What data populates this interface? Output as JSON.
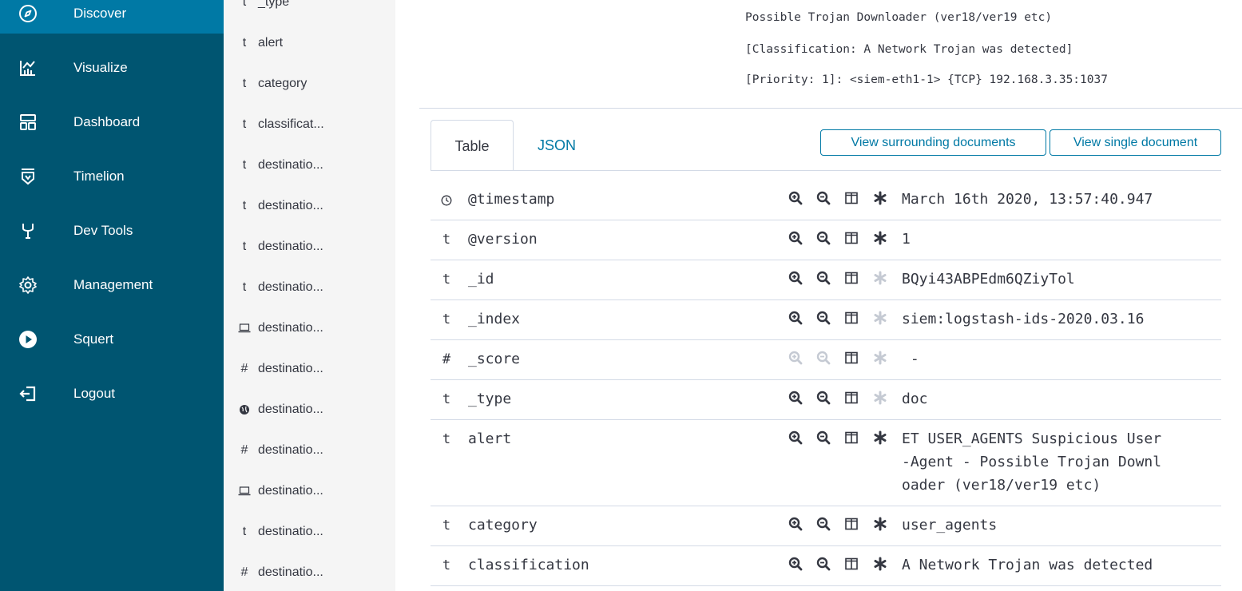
{
  "nav": {
    "items": [
      {
        "label": "Discover",
        "icon": "compass-icon",
        "active": true
      },
      {
        "label": "Visualize",
        "icon": "chart-icon"
      },
      {
        "label": "Dashboard",
        "icon": "dashboard-icon"
      },
      {
        "label": "Timelion",
        "icon": "timelion-icon"
      },
      {
        "label": "Dev Tools",
        "icon": "wrench-icon"
      },
      {
        "label": "Management",
        "icon": "gear-icon"
      },
      {
        "label": "Squert",
        "icon": "play-icon"
      },
      {
        "label": "Logout",
        "icon": "logout-icon"
      }
    ]
  },
  "fields": {
    "items": [
      {
        "type": "t",
        "name": "_type"
      },
      {
        "type": "t",
        "name": "alert"
      },
      {
        "type": "t",
        "name": "category"
      },
      {
        "type": "t",
        "name": "classificat..."
      },
      {
        "type": "t",
        "name": "destinatio..."
      },
      {
        "type": "t",
        "name": "destinatio..."
      },
      {
        "type": "t",
        "name": "destinatio..."
      },
      {
        "type": "t",
        "name": "destinatio..."
      },
      {
        "type": "laptop",
        "name": "destinatio..."
      },
      {
        "type": "#",
        "name": "destinatio..."
      },
      {
        "type": "globe",
        "name": "destinatio..."
      },
      {
        "type": "#",
        "name": "destinatio..."
      },
      {
        "type": "laptop",
        "name": "destinatio..."
      },
      {
        "type": "t",
        "name": "destinatio..."
      },
      {
        "type": "#",
        "name": "destinatio..."
      }
    ]
  },
  "summary": {
    "lines": [
      "Possible Trojan Downloader (ver18/ver19 etc)",
      "[Classification: A Network Trojan was detected]",
      "[Priority: 1]: <siem-eth1-1> {TCP} 192.168.3.35:1037"
    ]
  },
  "tabs": {
    "table": "Table",
    "json": "JSON"
  },
  "buttons": {
    "surrounding": "View surrounding documents",
    "single": "View single document"
  },
  "doc": {
    "rows": [
      {
        "type": "clock",
        "name": "@timestamp",
        "value": "March 16th 2020, 13:57:40.947",
        "filterable": true,
        "existsActive": true
      },
      {
        "type": "t",
        "name": "@version",
        "value": "1",
        "filterable": true,
        "existsActive": true
      },
      {
        "type": "t",
        "name": "_id",
        "value": "BQyi43ABPEdm6QZiyTol",
        "filterable": true,
        "existsActive": false,
        "link": true
      },
      {
        "type": "t",
        "name": "_index",
        "value": "siem:logstash-ids-2020.03.16",
        "filterable": true,
        "existsActive": false
      },
      {
        "type": "#",
        "name": "_score",
        "value": " -",
        "filterable": false,
        "existsActive": false
      },
      {
        "type": "t",
        "name": "_type",
        "value": "doc",
        "filterable": true,
        "existsActive": false
      },
      {
        "type": "t",
        "name": "alert",
        "value": "ET USER_AGENTS Suspicious User\n-Agent - Possible Trojan Downl\noader (ver18/ver19 etc)",
        "filterable": true,
        "existsActive": true
      },
      {
        "type": "t",
        "name": "category",
        "value": "user_agents",
        "filterable": true,
        "existsActive": true
      },
      {
        "type": "t",
        "name": "classification",
        "value": "A Network Trojan was detected",
        "filterable": true,
        "existsActive": true
      }
    ]
  },
  "colors": {
    "nav_bg": "#005571",
    "nav_active": "#0079a5",
    "link": "#0079a5",
    "text": "#343741"
  }
}
